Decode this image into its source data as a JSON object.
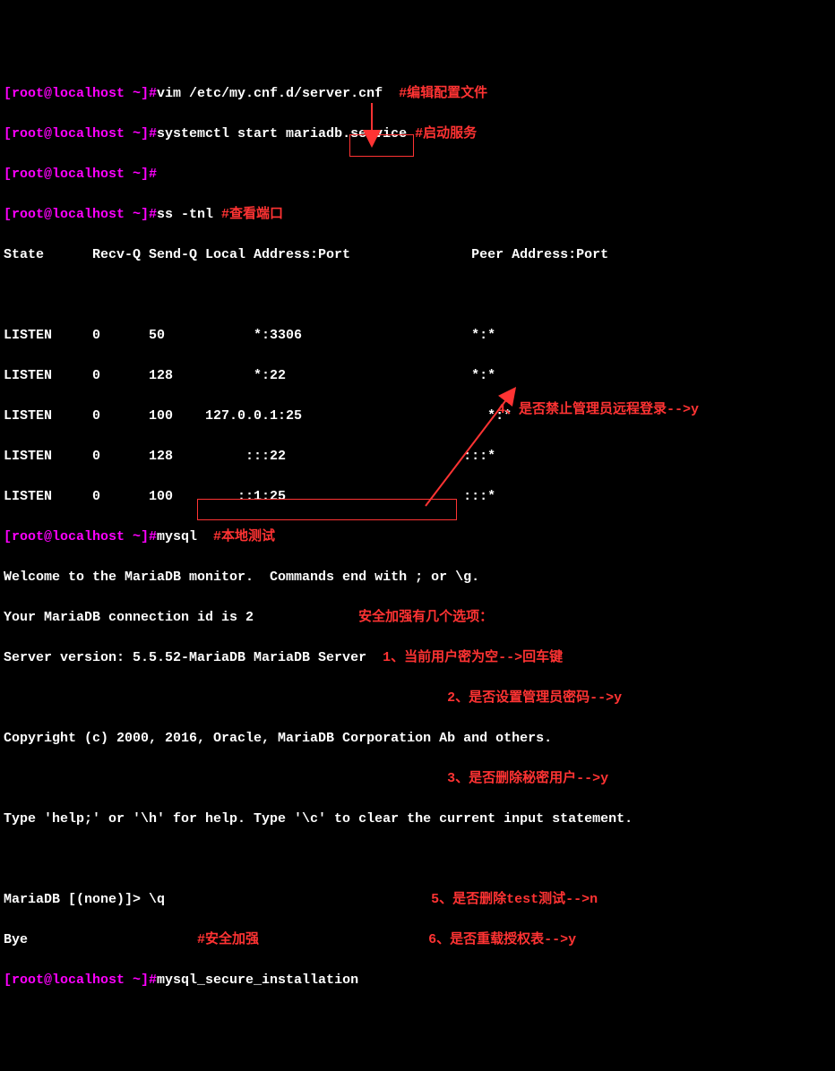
{
  "prompts": {
    "p1": "[root@localhost ~]#",
    "p2": "[root@localhost ~]#",
    "p3": "[root@localhost ~]#",
    "p4": "[root@localhost ~]#",
    "p5": "[root@localhost ~]#",
    "p6": "[root@localhost ~]#"
  },
  "commands": {
    "vim": "vim /etc/my.cnf.d/server.cnf  ",
    "systemctl": "systemctl start mariadb.service ",
    "ss": "ss -tnl ",
    "mysql": "mysql  ",
    "secure": "mysql_secure_installation"
  },
  "comments": {
    "edit": "#编辑配置文件",
    "start": "#启动服务",
    "port": "#查看端口",
    "localtest": "#本地测试",
    "secure": "#安全加强"
  },
  "table": {
    "header": "State      Recv-Q Send-Q Local Address:Port               Peer Address:Port",
    "r1": "LISTEN     0      50           *:3306                     *:*",
    "r2": "LISTEN     0      128          *:22                       *:*",
    "r3": "LISTEN     0      100    127.0.0.1:25                       *:*",
    "r4": "LISTEN     0      128         :::22                      :::*",
    "r5": "LISTEN     0      100        ::1:25                      :::*"
  },
  "mariadb": {
    "welcome": "Welcome to the MariaDB monitor.  Commands end with ; or \\g.",
    "connid": "Your MariaDB connection id is 2",
    "version": "Server version: 5.5.52-MariaDB MariaDB Server",
    "copyright": "Copyright (c) 2000, 2016, Oracle, MariaDB Corporation Ab and others.",
    "help": "Type 'help;' or '\\h' for help. Type '\\c' to clear the current input statement.",
    "prompt": "MariaDB [(none)]> \\q",
    "bye": "Bye"
  },
  "notes": {
    "title": "安全加强有几个选项：",
    "n1": "1、当前用户密为空-->回车键",
    "n2": "2、是否设置管理员密码-->y",
    "n3": "3、是否删除秘密用户-->y",
    "n4": "4、是否禁止管理员远程登录-->y",
    "n5": "5、是否删除test测试-->n",
    "n6": "6、是否重载授权表-->y"
  }
}
